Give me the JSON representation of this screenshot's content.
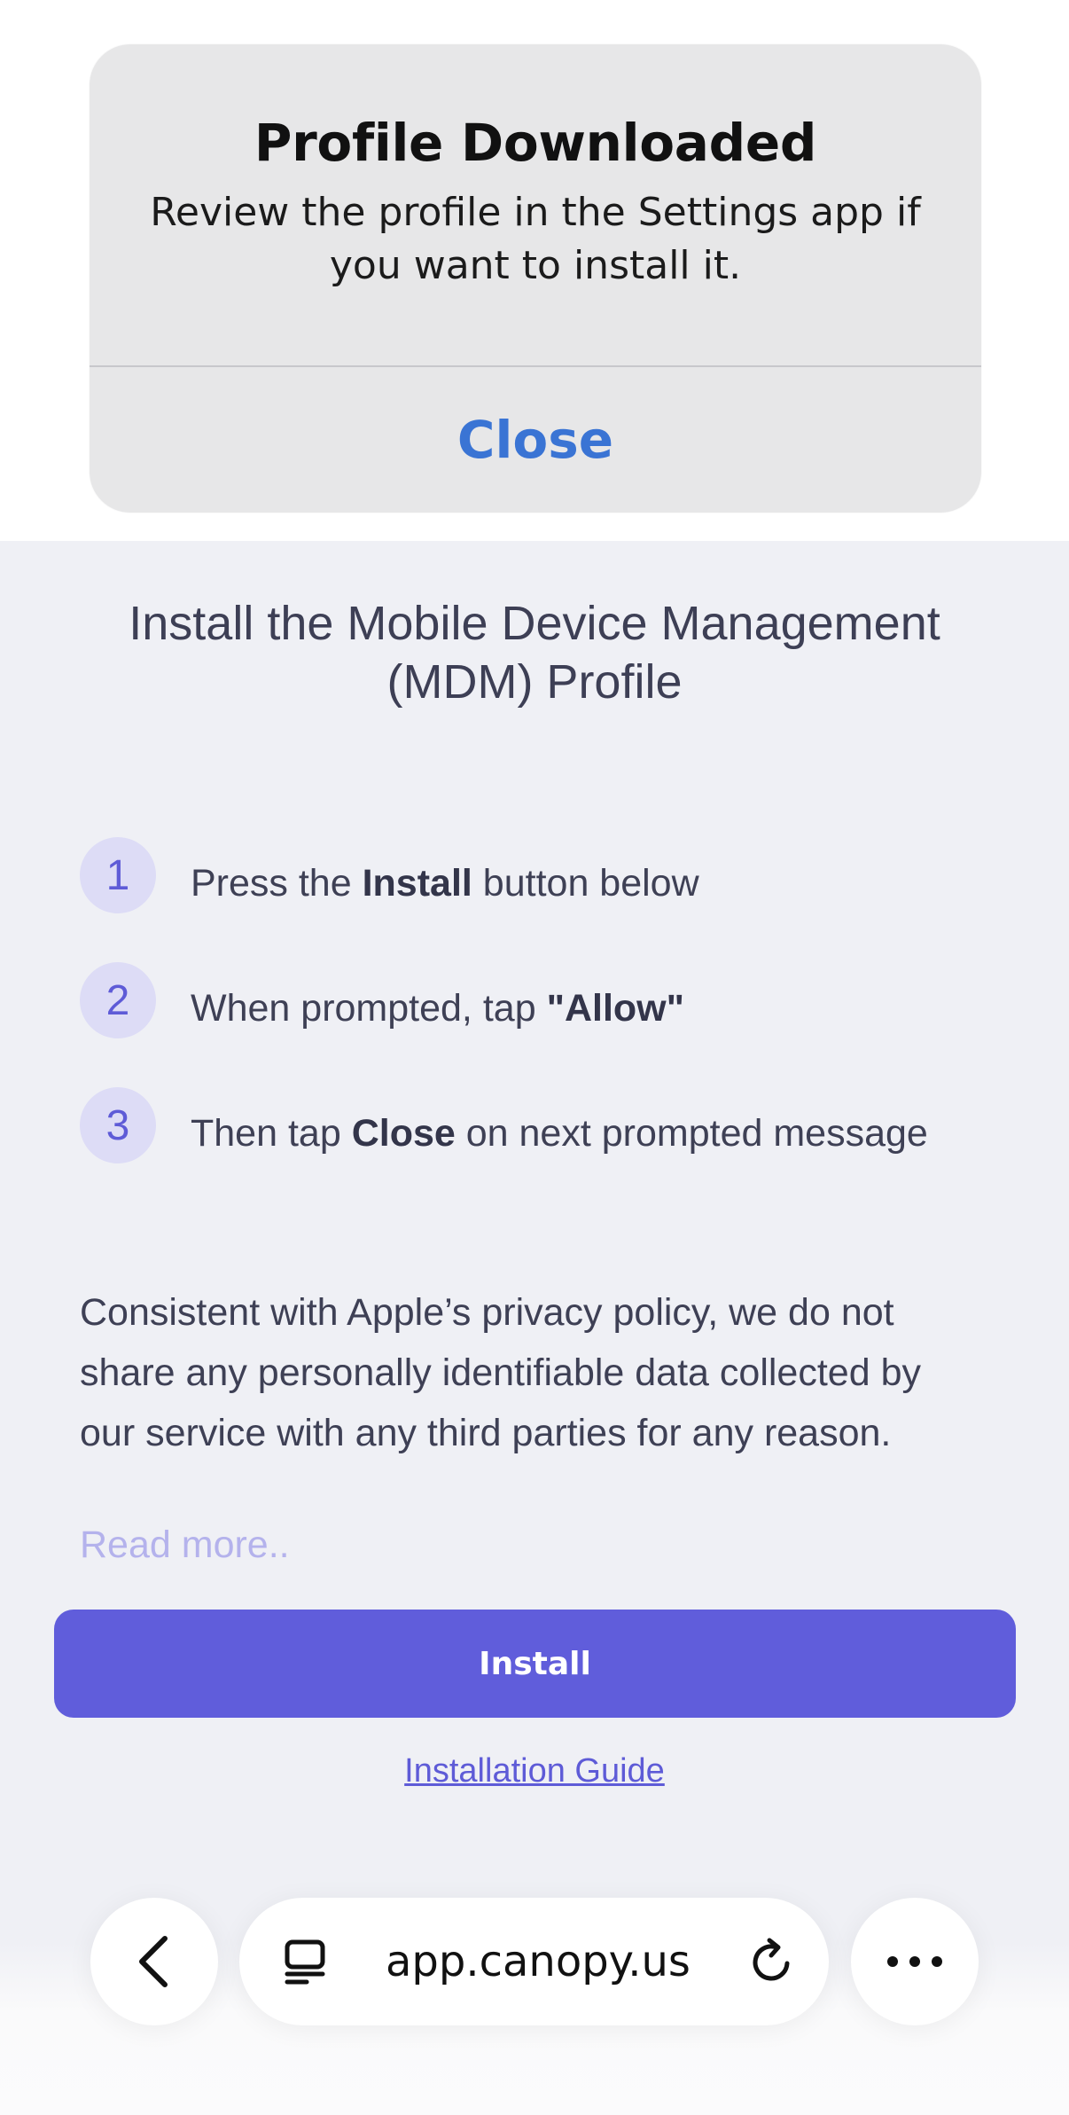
{
  "alert": {
    "title": "Profile Downloaded",
    "message": "Review the profile in the Settings app if you want to install it.",
    "close_label": "Close"
  },
  "main": {
    "heading": "Install the Mobile Device Management (MDM) Profile",
    "steps": [
      {
        "number": "1",
        "pre": "Press the ",
        "bold": "Install",
        "post": " button below"
      },
      {
        "number": "2",
        "pre": "When prompted, tap ",
        "bold": "\"Allow\"",
        "post": ""
      },
      {
        "number": "3",
        "pre": "Then tap ",
        "bold": "Close",
        "post": " on next prompted message"
      }
    ],
    "privacy_text": "Consistent with Apple’s privacy policy, we do not share any personally identifiable data collected by our service with any third parties for any reason.",
    "read_more": "Read more..",
    "install_label": "Install",
    "guide_link": "Installation Guide"
  },
  "browser": {
    "url": "app.canopy.us",
    "icons": {
      "back": "chevron-left-icon",
      "tabs": "tabs-icon",
      "reload": "reload-icon",
      "more": "more-icon"
    }
  }
}
